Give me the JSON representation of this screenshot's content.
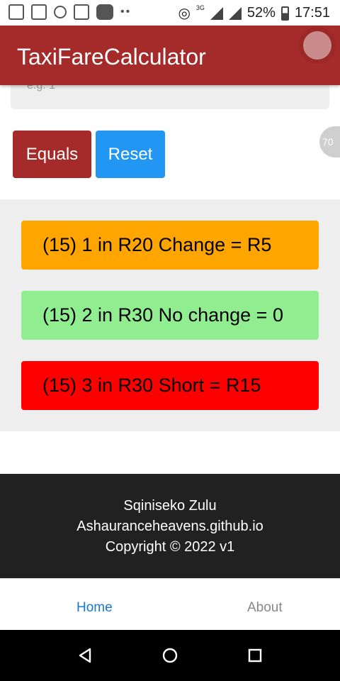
{
  "status_bar": {
    "network_label": "3G",
    "battery": "52%",
    "time": "17:51"
  },
  "app_bar": {
    "title": "TaxiFareCalculator"
  },
  "input": {
    "placeholder": "e.g. 1"
  },
  "buttons": {
    "equals": "Equals",
    "reset": "Reset"
  },
  "side_badge": "70",
  "results": [
    {
      "text": "(15) 1 in R20 Change = R5",
      "color": "#ffa500"
    },
    {
      "text": "(15) 2 in R30 No change = 0",
      "color": "#90ee90"
    },
    {
      "text": "(15) 3 in R30 Short = R15",
      "color": "#ff0000"
    }
  ],
  "footer": {
    "name": "Sqiniseko Zulu",
    "site": "Ashauranceheavens.github.io",
    "copyright": "Copyright © 2022 v1"
  },
  "bottom_nav": {
    "home": "Home",
    "about": "About",
    "active_color": "#1976d2"
  },
  "colors": {
    "primary": "#a52a2a",
    "accent": "#2196f3"
  }
}
